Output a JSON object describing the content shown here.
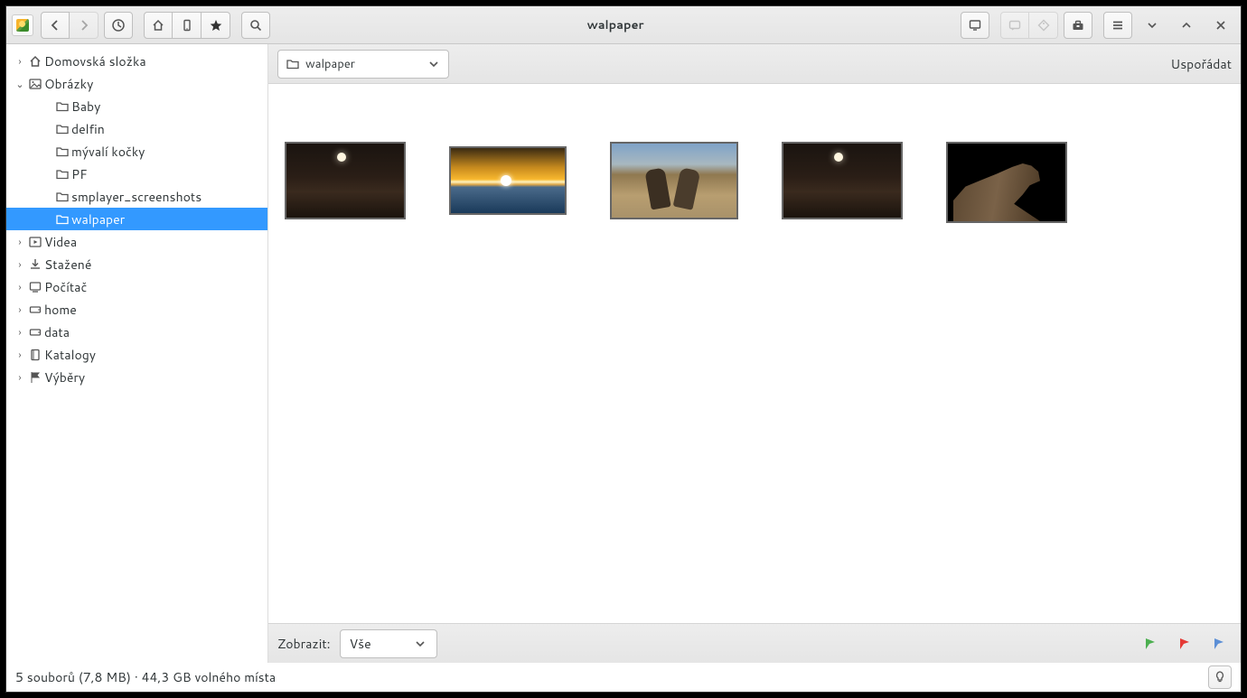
{
  "window": {
    "title": "walpaper"
  },
  "toolbar": {
    "icons": {
      "back": "back-icon",
      "forward": "forward-icon",
      "history": "history-icon",
      "home": "home-icon",
      "phone": "phone-icon",
      "star": "star-icon",
      "search": "search-icon",
      "screen": "screen-icon",
      "message": "message-icon",
      "tag": "tag-icon",
      "toolbox": "toolbox-icon",
      "menu": "menu-icon",
      "down": "chevron-down-icon",
      "up": "chevron-up-icon",
      "close": "close-icon"
    }
  },
  "sidebar": {
    "items": [
      {
        "icon": "home",
        "label": "Domovská složka",
        "expandable": true,
        "expanded": false,
        "depth": 0,
        "selected": false
      },
      {
        "icon": "image",
        "label": "Obrázky",
        "expandable": true,
        "expanded": true,
        "depth": 0,
        "selected": false
      },
      {
        "icon": "folder",
        "label": "Baby",
        "expandable": false,
        "depth": 1,
        "selected": false
      },
      {
        "icon": "folder",
        "label": "delfin",
        "expandable": false,
        "depth": 1,
        "selected": false
      },
      {
        "icon": "folder",
        "label": "mývalí kočky",
        "expandable": false,
        "depth": 1,
        "selected": false
      },
      {
        "icon": "folder",
        "label": "PF",
        "expandable": false,
        "depth": 1,
        "selected": false
      },
      {
        "icon": "folder",
        "label": "smplayer_screenshots",
        "expandable": false,
        "depth": 1,
        "selected": false
      },
      {
        "icon": "folder",
        "label": "walpaper",
        "expandable": false,
        "depth": 1,
        "selected": true
      },
      {
        "icon": "video",
        "label": "Videa",
        "expandable": true,
        "expanded": false,
        "depth": 0,
        "selected": false
      },
      {
        "icon": "download",
        "label": "Stažené",
        "expandable": true,
        "expanded": false,
        "depth": 0,
        "selected": false
      },
      {
        "icon": "computer",
        "label": "Počítač",
        "expandable": true,
        "expanded": false,
        "depth": 0,
        "selected": false
      },
      {
        "icon": "drive",
        "label": "home",
        "expandable": true,
        "expanded": false,
        "depth": 0,
        "selected": false
      },
      {
        "icon": "drive",
        "label": "data",
        "expandable": true,
        "expanded": false,
        "depth": 0,
        "selected": false
      },
      {
        "icon": "book",
        "label": "Katalogy",
        "expandable": true,
        "expanded": false,
        "depth": 0,
        "selected": false
      },
      {
        "icon": "flag",
        "label": "Výběry",
        "expandable": true,
        "expanded": false,
        "depth": 0,
        "selected": false
      }
    ]
  },
  "pathbar": {
    "current": "walpaper",
    "arrange": "Uspořádat"
  },
  "thumbnails": [
    {
      "kind": "night"
    },
    {
      "kind": "sunset"
    },
    {
      "kind": "horses"
    },
    {
      "kind": "night"
    },
    {
      "kind": "wolf"
    }
  ],
  "filterbar": {
    "label": "Zobrazit:",
    "value": "Vše",
    "flags": [
      "green",
      "red",
      "blue"
    ]
  },
  "statusbar": {
    "text": "5 souborů (7,8 MB)  ·  44,3 GB volného místa"
  }
}
